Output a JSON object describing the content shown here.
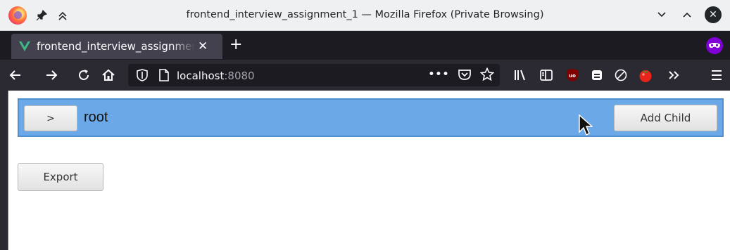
{
  "window": {
    "title": "frontend_interview_assignment_1 — Mozilla Firefox (Private Browsing)"
  },
  "tab": {
    "title": "frontend_interview_assignment_1",
    "icon": "vue-icon"
  },
  "url": {
    "host": "localhost",
    "port": ":8080"
  },
  "tree": {
    "root": {
      "toggle_label": ">",
      "label": "root",
      "add_child_label": "Add Child"
    }
  },
  "export_label": "Export",
  "colors": {
    "node_row_bg": "#6aa8e8",
    "private_badge": "#8000d7",
    "tabstrip_bg": "#1c1b22"
  }
}
